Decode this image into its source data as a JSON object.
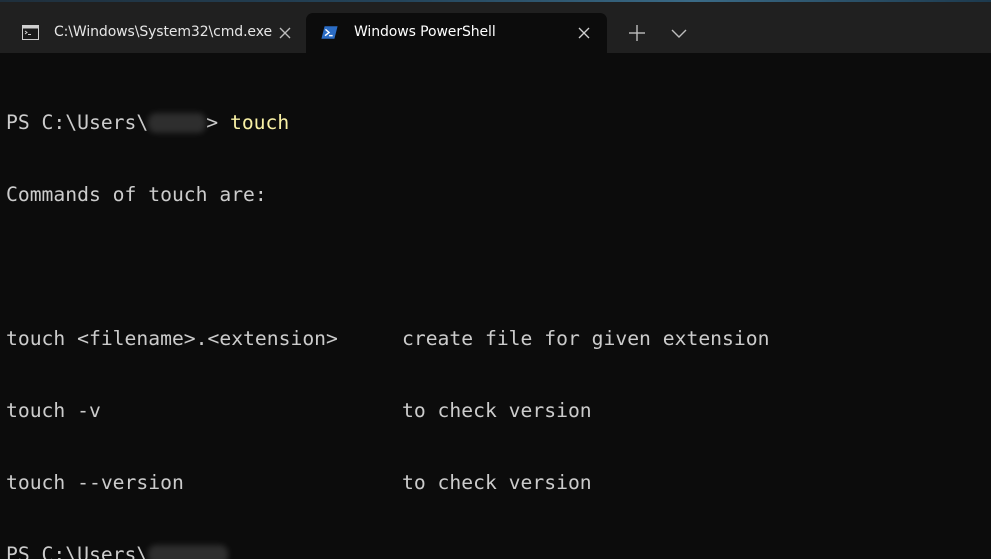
{
  "tabs": [
    {
      "title": "C:\\Windows\\System32\\cmd.exe",
      "icon": "cmd-icon",
      "active": false
    },
    {
      "title": "Windows PowerShell",
      "icon": "powershell-icon",
      "active": true
    }
  ],
  "tabbar": {
    "new_tab_icon": "plus-icon",
    "dropdown_icon": "chevron-down-icon"
  },
  "terminal": {
    "prompt1": "PS C:\\Users\\",
    "prompt1_suffix": "> ",
    "command": "touch",
    "intro": "Commands of touch are:",
    "rows": [
      {
        "syntax": "touch <filename>.<extension>",
        "description": "create file for given extension"
      },
      {
        "syntax": "touch -v",
        "description": "to check version"
      },
      {
        "syntax": "touch --version",
        "description": "to check version"
      }
    ],
    "prompt2": "PS C:\\Users\\"
  },
  "colors": {
    "background": "#0c0c0c",
    "titlebar": "#202020",
    "text": "#cccccc",
    "command": "#f9f1a5"
  }
}
